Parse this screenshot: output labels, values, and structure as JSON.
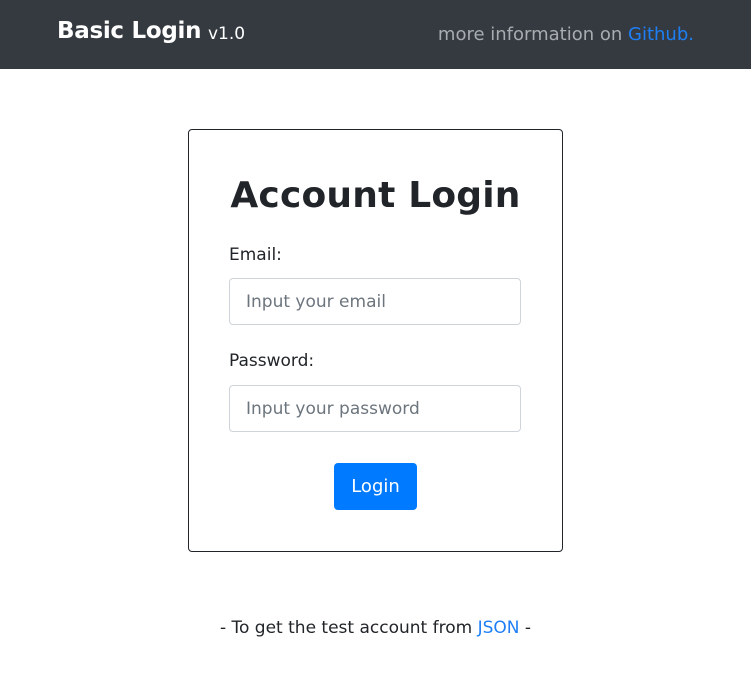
{
  "navbar": {
    "brand": "Basic Login",
    "version": "v1.0",
    "info_text": "more information on ",
    "info_link": "Github."
  },
  "login_card": {
    "title": "Account Login",
    "email_label": "Email:",
    "email_placeholder": "Input your email",
    "email_value": "",
    "password_label": "Password:",
    "password_placeholder": "Input your password",
    "password_value": "",
    "login_button": "Login"
  },
  "footer": {
    "prefix": "- To get the test account from ",
    "link": "JSON",
    "suffix": " -"
  },
  "colors": {
    "navbar_bg": "#343a40",
    "accent": "#007bff",
    "link": "#1e7ff5"
  }
}
